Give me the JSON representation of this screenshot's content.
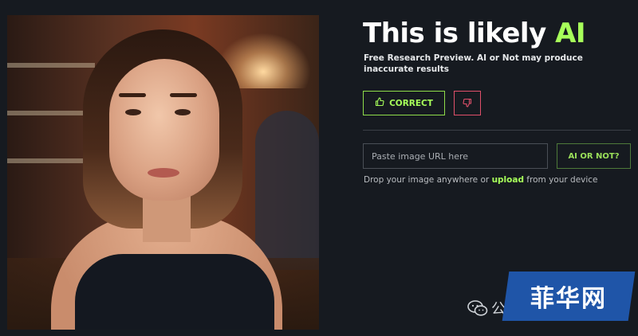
{
  "result": {
    "title_prefix": "This is likely ",
    "title_verdict": "AI",
    "subtitle": "Free Research Preview. AI or Not may produce inaccurate results"
  },
  "feedback": {
    "correct_label": "CORRECT",
    "correct_icon": "thumbs-up-icon",
    "wrong_icon": "thumbs-down-icon"
  },
  "search": {
    "placeholder": "Paste image URL here",
    "submit_label": "AI OR NOT?"
  },
  "drop": {
    "prefix": "Drop your image anywhere or ",
    "link": "upload",
    "suffix": " from your device"
  },
  "watermark": {
    "text": "菲华网",
    "partial_char": "公"
  },
  "colors": {
    "background": "#161a20",
    "accent_green": "#a7ff5a",
    "accent_red": "#e0506a",
    "watermark_blue": "#1f55a8"
  }
}
